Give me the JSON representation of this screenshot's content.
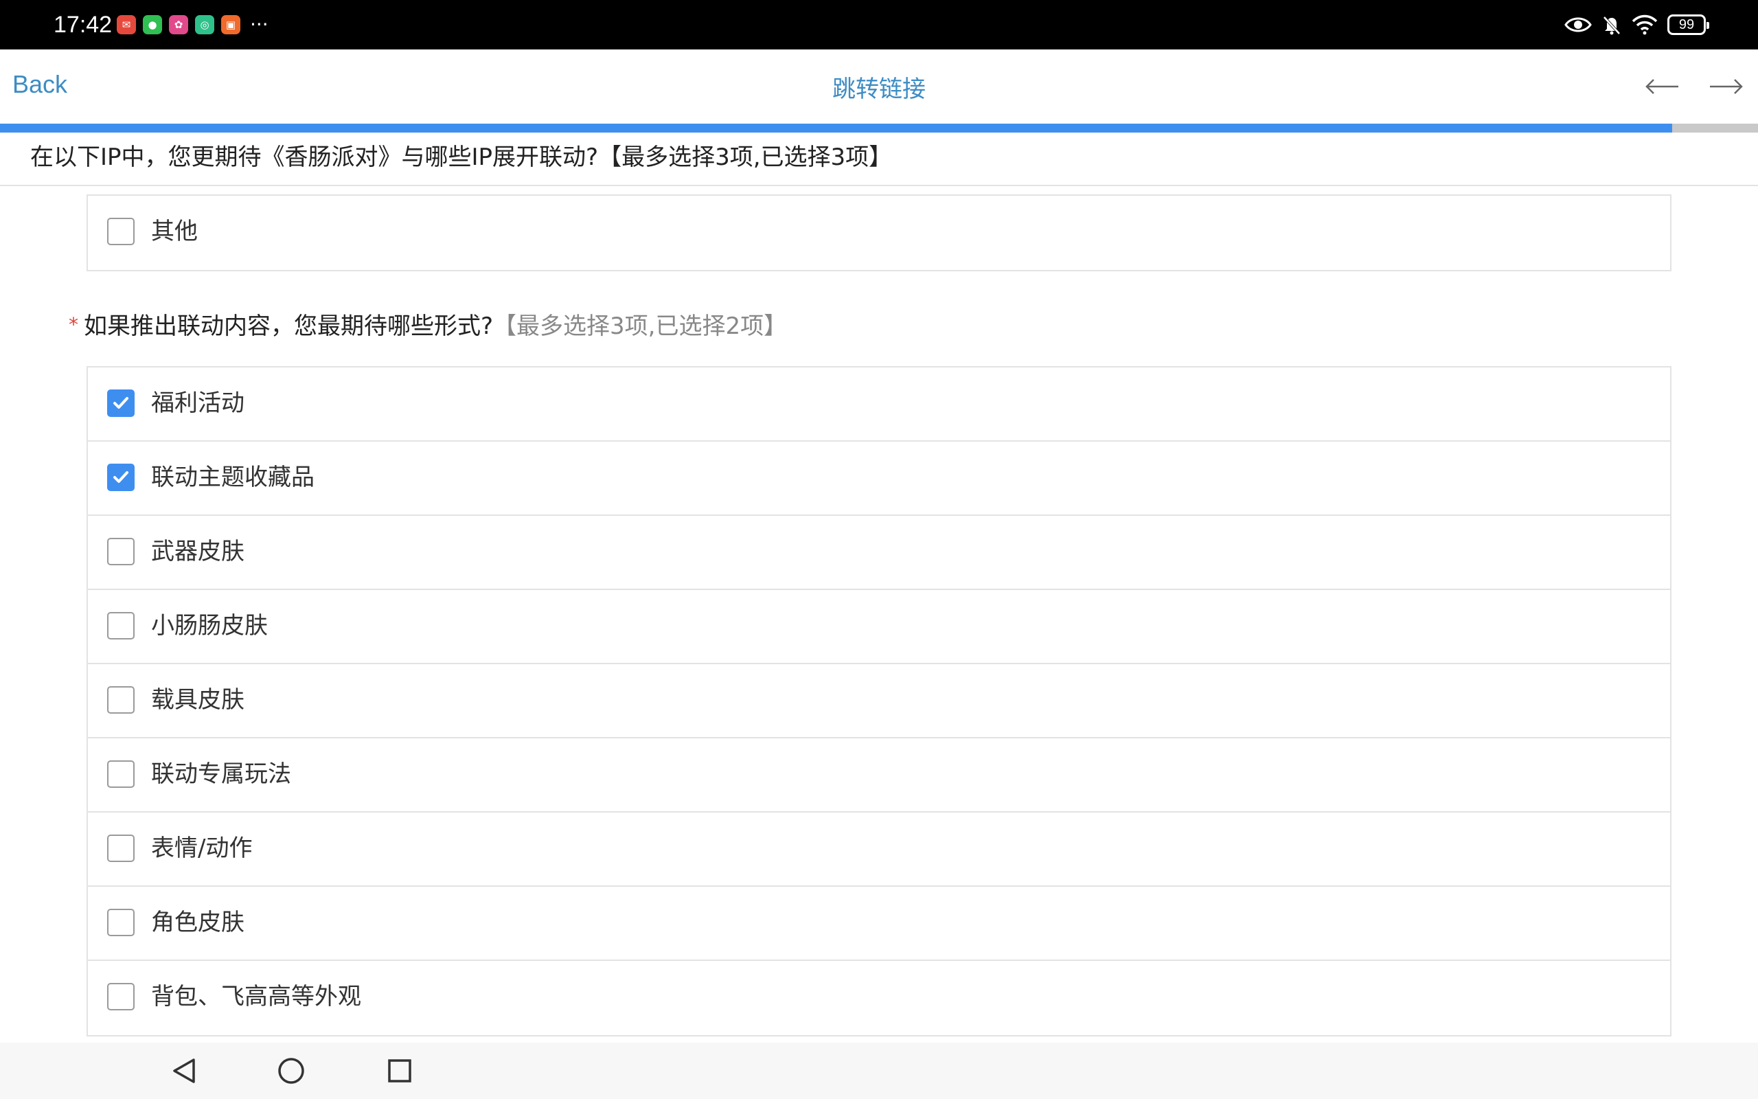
{
  "status_bar": {
    "time": "17:42",
    "app_icons": [
      {
        "name": "mail-app-icon",
        "color": "#e5493d",
        "glyph": "✉"
      },
      {
        "name": "wechat-app-icon",
        "color": "#2fbf52",
        "glyph": "●"
      },
      {
        "name": "game-app-icon",
        "color": "#e24a8b",
        "glyph": "✿"
      },
      {
        "name": "camera-app-icon",
        "color": "#2fc18a",
        "glyph": "◎"
      },
      {
        "name": "store-app-icon",
        "color": "#f06a2c",
        "glyph": "▣"
      }
    ],
    "more": "···",
    "battery": "99"
  },
  "nav": {
    "back_label": "Back",
    "title": "跳转链接"
  },
  "progress": {
    "fraction": 0.951,
    "fill_color": "#3e8ef0"
  },
  "sticky_question": "在以下IP中，您更期待《香肠派对》与哪些IP展开联动?【最多选择3项,已选择3项】",
  "q1_tail_option": {
    "label": "其他",
    "checked": false
  },
  "q2": {
    "required_mark": "*",
    "text": "如果推出联动内容，您最期待哪些形式?",
    "hint": "【最多选择3项,已选择2项】",
    "options": [
      {
        "label": "福利活动",
        "checked": true
      },
      {
        "label": "联动主题收藏品",
        "checked": true
      },
      {
        "label": "武器皮肤",
        "checked": false
      },
      {
        "label": "小肠肠皮肤",
        "checked": false
      },
      {
        "label": "载具皮肤",
        "checked": false
      },
      {
        "label": "联动专属玩法",
        "checked": false
      },
      {
        "label": "表情/动作",
        "checked": false
      },
      {
        "label": "角色皮肤",
        "checked": false
      },
      {
        "label": "背包、飞高高等外观",
        "checked": false
      }
    ]
  },
  "accent_color": "#3d8cc4"
}
